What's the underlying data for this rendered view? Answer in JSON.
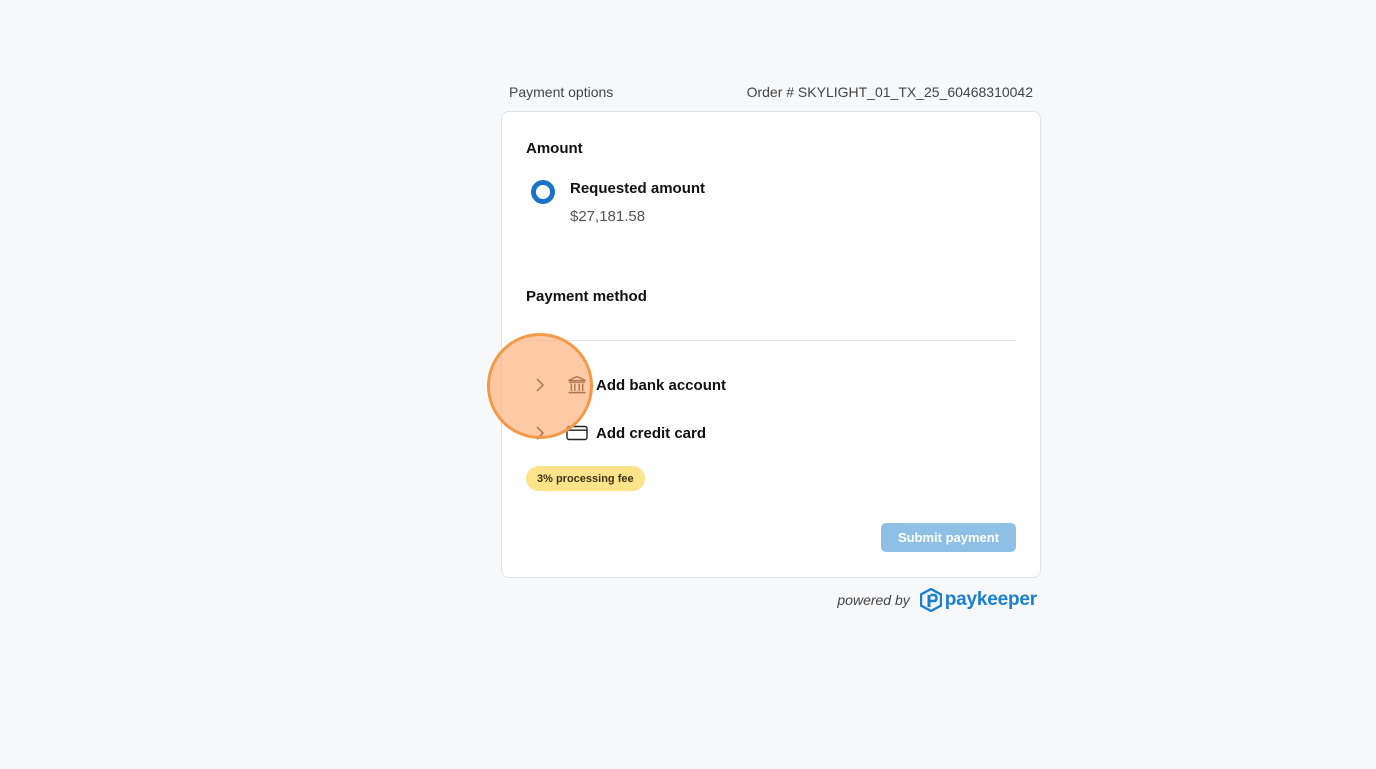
{
  "header": {
    "title": "Payment options",
    "order": "Order # SKYLIGHT_01_TX_25_60468310042"
  },
  "amount": {
    "title": "Amount",
    "option_label": "Requested amount",
    "option_value": "$27,181.58",
    "selected": true
  },
  "payment_method": {
    "title": "Payment method",
    "methods": [
      {
        "label": "Add bank account",
        "icon": "bank-icon"
      },
      {
        "label": "Add credit card",
        "icon": "credit-card-icon"
      }
    ],
    "fee_badge": "3% processing fee"
  },
  "submit_label": "Submit payment",
  "footer": {
    "powered_by": "powered by",
    "brand": "paykeeper"
  },
  "colors": {
    "accent": "#1a73c8",
    "submit_disabled": "#8ec0e6",
    "fee_badge": "#fde38a",
    "brand": "#1b7fcf",
    "cursor_highlight": "#f29a48"
  }
}
